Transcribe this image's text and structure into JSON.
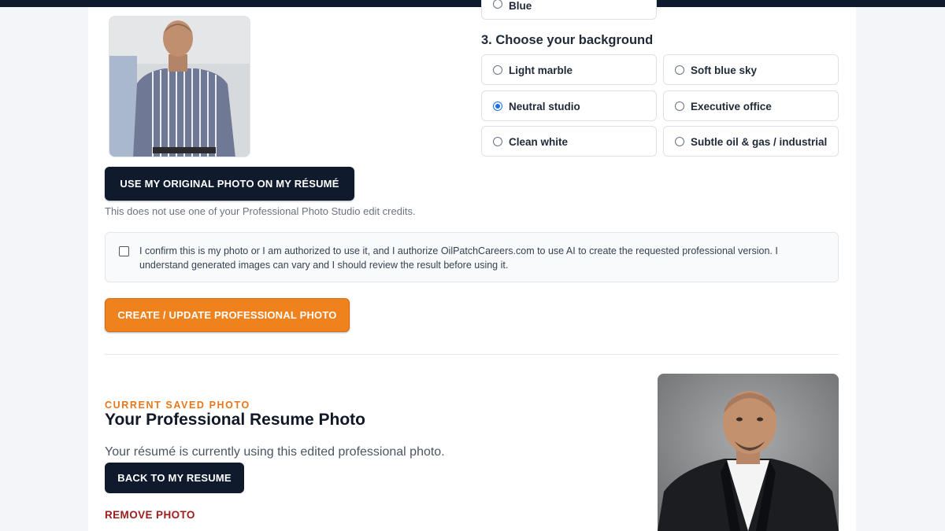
{
  "options_above": {
    "partial_label": "Blue"
  },
  "background_section": {
    "title": "3. Choose your background",
    "options": [
      {
        "label": "Light marble",
        "selected": false
      },
      {
        "label": "Soft blue sky",
        "selected": false
      },
      {
        "label": "Neutral studio",
        "selected": true
      },
      {
        "label": "Executive office",
        "selected": false
      },
      {
        "label": "Clean white",
        "selected": false
      },
      {
        "label": "Subtle oil & gas / industrial",
        "selected": false
      }
    ]
  },
  "original": {
    "use_button": "Use my original photo on my résumé",
    "hint": "This does not use one of your Professional Photo Studio edit credits."
  },
  "consent": {
    "checked": false,
    "text": "I confirm this is my photo or I am authorized to use it, and I authorize OilPatchCareers.com to use AI to create the requested professional version. I understand generated images can vary and I should review the result before using it."
  },
  "create_button": "Create / Update Professional Photo",
  "current": {
    "eyebrow": "CURRENT SAVED PHOTO",
    "title": "Your Professional Resume Photo",
    "description": "Your résumé is currently using this edited professional photo.",
    "back_button": "Back to my resume",
    "remove_link": "Remove photo"
  },
  "colors": {
    "navy": "#0f1b2d",
    "orange": "#f0821e",
    "remove_red": "#a11d1d",
    "radio_blue": "#1a6fe0"
  }
}
